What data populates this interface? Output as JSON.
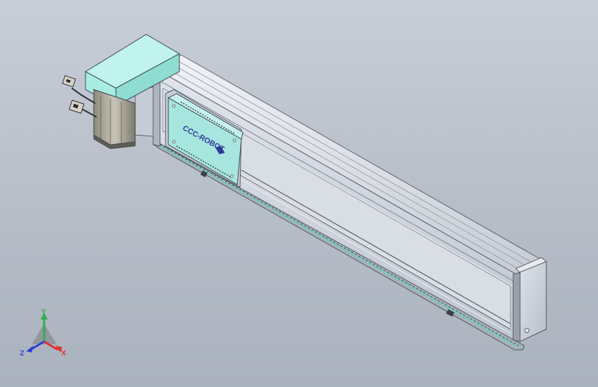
{
  "model": {
    "name": "linear-actuator",
    "carriage_logo": "CCC-ROBOT"
  },
  "triad": {
    "x_label": "X",
    "y_label": "Y",
    "z_label": "Z",
    "x_color": "#e0302a",
    "y_color": "#2bb24c",
    "z_color": "#2a3fd6"
  },
  "colors": {
    "motor_cover": "#a8ede4",
    "profile": "#d2d7df",
    "endcap": "#cfd5de",
    "carriage_plate": "#a6e6df",
    "logo_ink": "#2d3a9a"
  }
}
